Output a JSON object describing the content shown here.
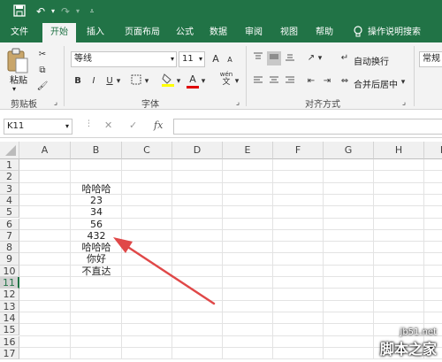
{
  "tabs": [
    "文件",
    "开始",
    "插入",
    "页面布局",
    "公式",
    "数据",
    "审阅",
    "视图",
    "帮助",
    "操作说明搜索"
  ],
  "ribbon": {
    "paste_label": "粘贴",
    "clipboard_label": "剪贴板",
    "font_name": "等线",
    "font_size": "11",
    "font_group_label": "字体",
    "wrap_text": "自动换行",
    "merge_center": "合并后居中",
    "alignment_label": "对齐方式",
    "number_format": "常规",
    "bold": "B",
    "italic": "I",
    "underline": "U",
    "font_color_letter": "A",
    "grow_font": "A",
    "shrink_font": "A",
    "wen_label": "wén",
    "wen_char": "文",
    "colors": {
      "highlight": "#ffff00",
      "font_color": "#e00000"
    }
  },
  "formula_bar": {
    "name_box": "K11",
    "cancel": "✕",
    "enter": "✓",
    "fx": "fx",
    "value": ""
  },
  "columns": [
    "A",
    "B",
    "C",
    "D",
    "E",
    "F",
    "G",
    "H",
    "I"
  ],
  "rows": [
    "1",
    "2",
    "3",
    "4",
    "5",
    "6",
    "7",
    "8",
    "9",
    "10",
    "11",
    "12",
    "13",
    "14",
    "15",
    "16",
    "17"
  ],
  "selected_row": "11",
  "column_b_values": [
    "",
    "",
    "哈哈哈",
    "23",
    "34",
    "56",
    "432",
    "哈哈哈",
    "你好",
    "不直达",
    "",
    "",
    "",
    "",
    "",
    "",
    ""
  ],
  "watermark": {
    "url": "jb51.net",
    "name": "脚本之家"
  },
  "theme": {
    "accent": "#217346",
    "arrow": "#e04848"
  }
}
